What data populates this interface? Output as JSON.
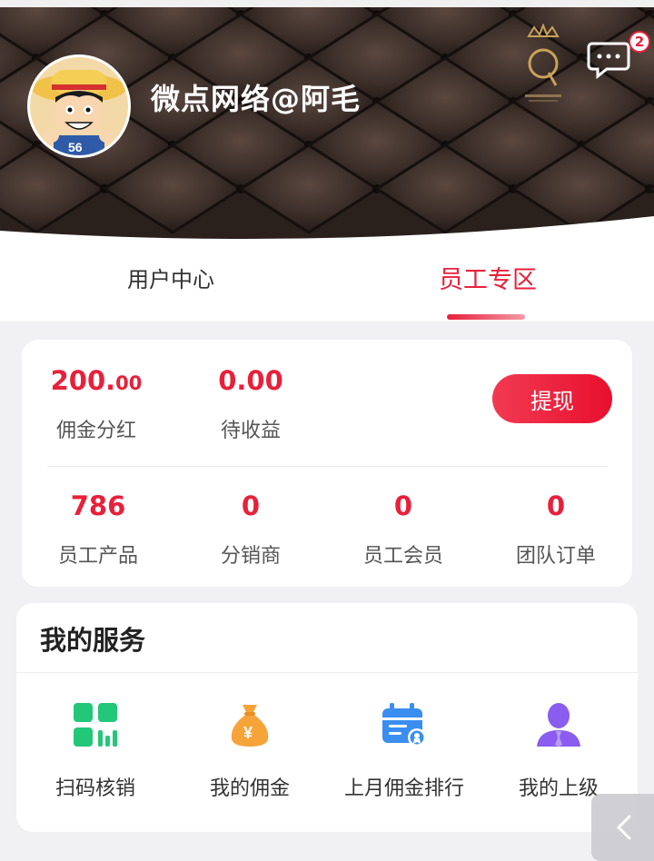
{
  "header": {
    "username": "微点网络@阿毛",
    "message_badge": "2",
    "icons": {
      "avatar": "avatar-image",
      "message": "chat-bubble-icon",
      "logo": "queen-crown-logo"
    }
  },
  "tabs": [
    {
      "label": "用户中心",
      "active": false
    },
    {
      "label": "员工专区",
      "active": true
    }
  ],
  "earnings": {
    "commission": {
      "value_int": "200.",
      "value_dec": "00",
      "label": "佣金分红"
    },
    "pending": {
      "value": "0.00",
      "label": "待收益"
    },
    "withdraw_label": "提现"
  },
  "counts": [
    {
      "value": "786",
      "label": "员工产品"
    },
    {
      "value": "0",
      "label": "分销商"
    },
    {
      "value": "0",
      "label": "员工会员"
    },
    {
      "value": "0",
      "label": "团队订单"
    }
  ],
  "services": {
    "title": "我的服务",
    "items": [
      {
        "label": "扫码核销",
        "icon": "scan-verify-icon"
      },
      {
        "label": "我的佣金",
        "icon": "money-bag-icon"
      },
      {
        "label": "上月佣金排行",
        "icon": "calendar-ranking-icon"
      },
      {
        "label": "我的上级",
        "icon": "superior-user-icon"
      }
    ]
  },
  "colors": {
    "accent": "#e8203a",
    "scan": "#22c77a",
    "bag": "#f6a33a",
    "calendar": "#3a8ef0",
    "user": "#8a5cf0"
  }
}
